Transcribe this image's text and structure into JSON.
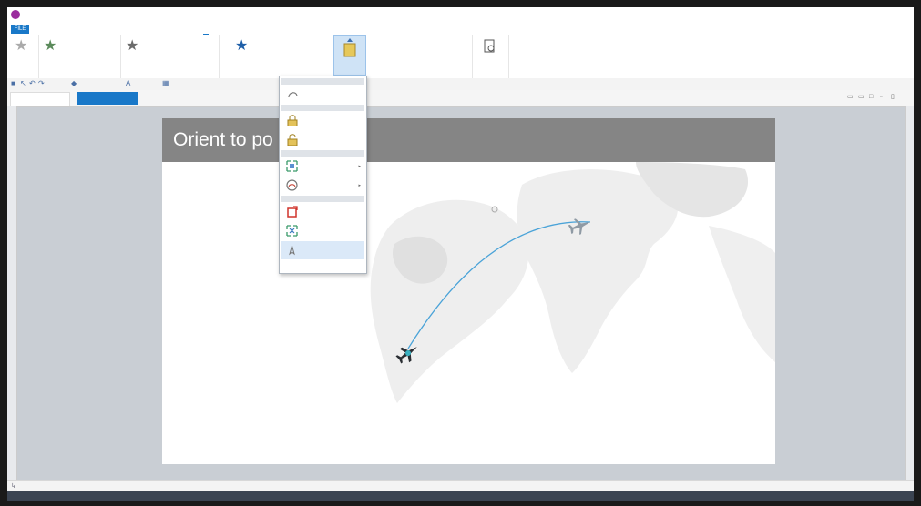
{
  "window": {
    "title": "",
    "accent": "#1978c8"
  },
  "ribbon_tabs": [
    {
      "label": "FILE"
    },
    {
      "label": ""
    },
    {
      "label": ""
    },
    {
      "label": ""
    },
    {
      "label": ""
    },
    {
      "label": ""
    },
    {
      "label": ""
    },
    {
      "label": ""
    },
    {
      "label": ""
    }
  ],
  "view_tabs": {
    "contents": "",
    "layout": ""
  },
  "layout": {
    "title": "Orient to po"
  },
  "dropdown": {
    "items": [
      {
        "label": "",
        "icon": "rotate-icon"
      },
      {
        "label": "",
        "icon": "lock-icon"
      },
      {
        "label": "",
        "icon": "unlock-icon"
      },
      {
        "label": "",
        "icon": "direction-icon"
      },
      {
        "label": "",
        "icon": "speed-icon"
      },
      {
        "label": "",
        "icon": "reset-rotation-icon"
      },
      {
        "label": "",
        "icon": "reset-position-icon"
      },
      {
        "label": "",
        "icon": "orient-path-icon"
      }
    ]
  },
  "statusbar": {
    "text": ""
  }
}
